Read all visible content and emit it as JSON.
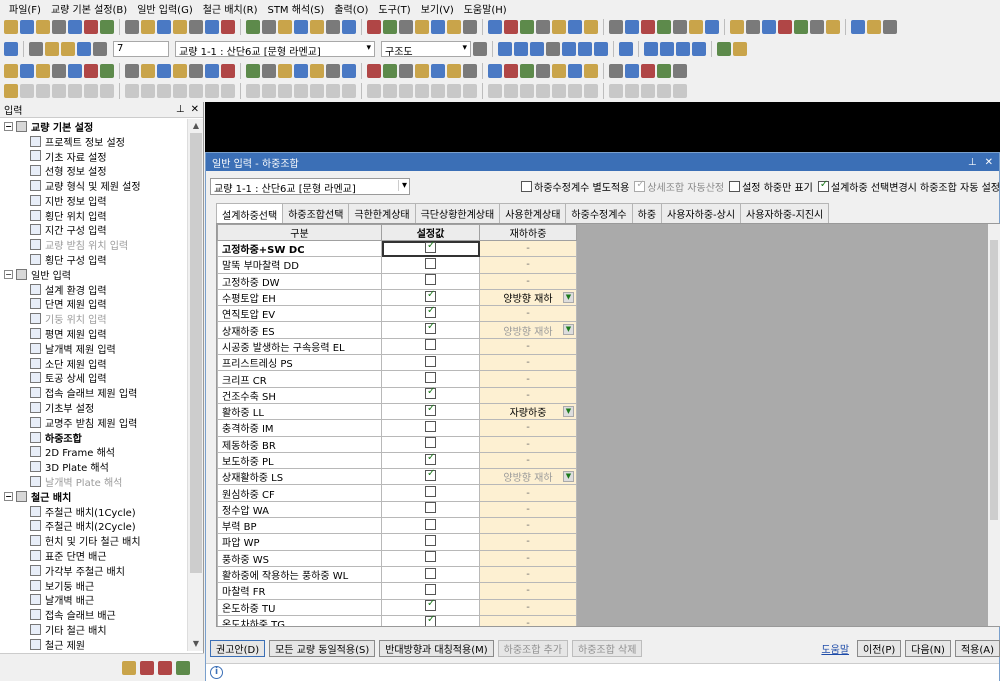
{
  "menu": [
    "파일(F)",
    "교량 기본 설정(B)",
    "일반 입력(G)",
    "철근 배치(R)",
    "STM 해석(S)",
    "출력(O)",
    "도구(T)",
    "보기(V)",
    "도움말(H)"
  ],
  "toolbar": {
    "page_input": "7",
    "bridge_select": "교량 1-1 : 산단6교 [문형 라멘교]",
    "view_select": "구조도"
  },
  "left_panel": {
    "title": "입력",
    "pin_icon": "pin-icon",
    "close_icon": "close-icon",
    "tree": [
      {
        "label": "교량 기본 설정",
        "level": 0,
        "toggle": "−",
        "bold": true
      },
      {
        "label": "프로젝트 정보 설정",
        "level": 1
      },
      {
        "label": "기초 자료 설정",
        "level": 1
      },
      {
        "label": "선형 정보 설정",
        "level": 1
      },
      {
        "label": "교량 형식 및 제원 설정",
        "level": 1
      },
      {
        "label": "지반 정보 입력",
        "level": 1
      },
      {
        "label": "횡단 위치 입력",
        "level": 1
      },
      {
        "label": "지간 구성 입력",
        "level": 1
      },
      {
        "label": "교량 받침 위치 입력",
        "level": 1,
        "gray": true
      },
      {
        "label": "횡단 구성 입력",
        "level": 1
      },
      {
        "label": "일반 입력",
        "level": 0,
        "toggle": "−"
      },
      {
        "label": "설계 환경 입력",
        "level": 1
      },
      {
        "label": "단면 제원 입력",
        "level": 1
      },
      {
        "label": "기둥 위치 입력",
        "level": 1,
        "gray": true
      },
      {
        "label": "평면 제원 입력",
        "level": 1
      },
      {
        "label": "날개벽 제원 입력",
        "level": 1
      },
      {
        "label": "소단 제원 입력",
        "level": 1
      },
      {
        "label": "토공 상세 입력",
        "level": 1
      },
      {
        "label": "접속 슬래브 제원 입력",
        "level": 1
      },
      {
        "label": "기초부 설정",
        "level": 1
      },
      {
        "label": "교명주 받침 제원 입력",
        "level": 1
      },
      {
        "label": "하중조합",
        "level": 1,
        "bold": true
      },
      {
        "label": "2D Frame 해석",
        "level": 1
      },
      {
        "label": "3D Plate 해석",
        "level": 1
      },
      {
        "label": "날개벽 Plate 해석",
        "level": 1,
        "gray": true
      },
      {
        "label": "철근 배치",
        "level": 0,
        "toggle": "−",
        "bold": true
      },
      {
        "label": "주철근 배치(1Cycle)",
        "level": 1
      },
      {
        "label": "주철근 배치(2Cycle)",
        "level": 1
      },
      {
        "label": "헌치 및 기타 철근 배치",
        "level": 1
      },
      {
        "label": "표준 단면 배근",
        "level": 1
      },
      {
        "label": "가각부 주철근 배치",
        "level": 1
      },
      {
        "label": "보기둥 배근",
        "level": 1
      },
      {
        "label": "날개벽 배근",
        "level": 1
      },
      {
        "label": "접속 슬래브 배근",
        "level": 1
      },
      {
        "label": "기타 철근 배치",
        "level": 1
      },
      {
        "label": "철근 제원",
        "level": 1
      }
    ]
  },
  "dialog": {
    "title": "일반 입력 - 하중조합",
    "bridge_select": "교량 1-1 : 산단6교 [문형 라멘교]",
    "options": [
      {
        "label": "하중수정계수 별도적용",
        "checked": false,
        "dim": false
      },
      {
        "label": "상세조합 자동산정",
        "checked": true,
        "dim": true
      },
      {
        "label": "설정 하중만 표기",
        "checked": false,
        "dim": false
      },
      {
        "label": "설계하중 선택변경시 하중조합 자동 설정",
        "checked": true,
        "dim": false
      }
    ],
    "tabs": [
      "설계하중선택",
      "하중조합선택",
      "극한한계상태",
      "극단상황한계상태",
      "사용한계상태",
      "하중수정계수",
      "하중",
      "사용자하중-상시",
      "사용자하중-지진시"
    ],
    "active_tab": 0,
    "columns": [
      "구분",
      "설정값",
      "재하하중"
    ],
    "rows": [
      {
        "name": "고정하중+SW DC",
        "bold": true,
        "checked": true,
        "load": "-",
        "dd": false
      },
      {
        "name": "말뚝 부마찰력 DD",
        "checked": false,
        "load": "-",
        "dd": false
      },
      {
        "name": "고정하중 DW",
        "checked": false,
        "load": "-",
        "dd": false
      },
      {
        "name": "수평토압 EH",
        "checked": true,
        "load": "양방향 재하",
        "dd": true
      },
      {
        "name": "연직토압 EV",
        "checked": true,
        "load": "-",
        "dd": false
      },
      {
        "name": "상재하중 ES",
        "checked": true,
        "load": "양방향 재하",
        "dd": true,
        "dim": true
      },
      {
        "name": "시공중 발생하는 구속응력 EL",
        "checked": false,
        "load": "-",
        "dd": false
      },
      {
        "name": "프리스트레싱 PS",
        "checked": false,
        "load": "-",
        "dd": false
      },
      {
        "name": "크리프 CR",
        "checked": false,
        "load": "-",
        "dd": false
      },
      {
        "name": "건조수축 SH",
        "checked": true,
        "load": "-",
        "dd": false
      },
      {
        "name": "활하중 LL",
        "checked": true,
        "load": "자량하중",
        "dd": true
      },
      {
        "name": "충격하중 IM",
        "checked": false,
        "load": "-",
        "dd": false
      },
      {
        "name": "제동하중 BR",
        "checked": false,
        "load": "-",
        "dd": false
      },
      {
        "name": "보도하중 PL",
        "checked": true,
        "load": "-",
        "dd": false
      },
      {
        "name": "상재활하중 LS",
        "checked": true,
        "load": "양방향 재하",
        "dd": true,
        "dim": true
      },
      {
        "name": "원심하중 CF",
        "checked": false,
        "load": "-",
        "dd": false
      },
      {
        "name": "정수압 WA",
        "checked": false,
        "load": "-",
        "dd": false
      },
      {
        "name": "부력 BP",
        "checked": false,
        "load": "-",
        "dd": false
      },
      {
        "name": "파압 WP",
        "checked": false,
        "load": "-",
        "dd": false
      },
      {
        "name": "풍하중 WS",
        "checked": false,
        "load": "-",
        "dd": false
      },
      {
        "name": "활하중에 작용하는 풍하중 WL",
        "checked": false,
        "load": "-",
        "dd": false
      },
      {
        "name": "마찰력 FR",
        "checked": false,
        "load": "-",
        "dd": false
      },
      {
        "name": "온도하중 TU",
        "checked": true,
        "load": "-",
        "dd": false
      },
      {
        "name": "온도차하중 TG",
        "checked": true,
        "load": "-",
        "dd": false
      }
    ],
    "buttons": [
      {
        "label": "권고안(D)",
        "dim": false,
        "hl": true
      },
      {
        "label": "모든 교량 동일적용(S)",
        "dim": false
      },
      {
        "label": "반대방향과 대칭적용(M)",
        "dim": false
      },
      {
        "label": "하중조합 추가",
        "dim": true
      },
      {
        "label": "하중조합 삭제",
        "dim": true
      }
    ],
    "help_link": "도움말",
    "nav_buttons": [
      "이전(P)",
      "다음(N)",
      "적용(A)"
    ],
    "status_icon": "info-icon"
  },
  "colors": {
    "title_bar": "#3b6fb6",
    "load_cell": "#fdf0d2",
    "check": "#1d7a1d"
  }
}
